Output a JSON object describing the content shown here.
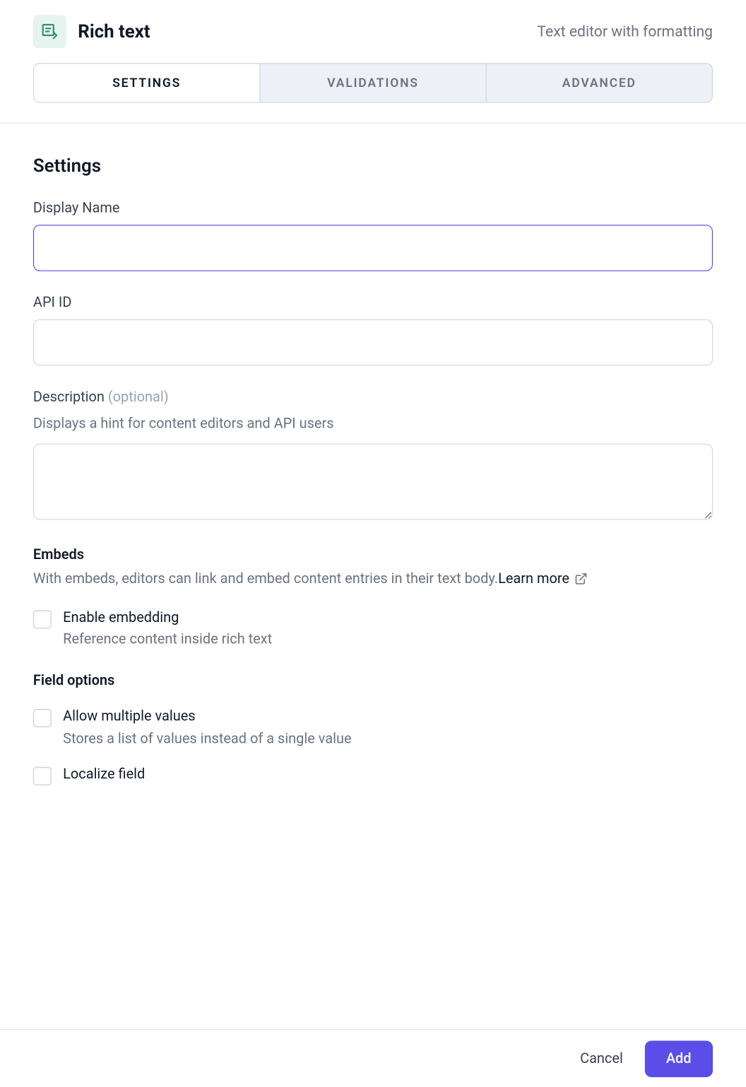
{
  "header": {
    "title": "Rich text",
    "subtitle": "Text editor with formatting",
    "icon": "rich-text-icon"
  },
  "tabs": {
    "items": [
      {
        "label": "Settings",
        "active": true
      },
      {
        "label": "Validations",
        "active": false
      },
      {
        "label": "Advanced",
        "active": false
      }
    ]
  },
  "settings": {
    "heading": "Settings",
    "displayName": {
      "label": "Display Name",
      "value": ""
    },
    "apiId": {
      "label": "API ID",
      "value": ""
    },
    "description": {
      "label": "Description",
      "optional": "(optional)",
      "hint": "Displays a hint for content editors and API users",
      "value": ""
    },
    "embeds": {
      "heading": "Embeds",
      "desc": "With embeds, editors can link and embed content entries in their text body.",
      "learn": "Learn more",
      "enable": {
        "label": "Enable embedding",
        "sub": "Reference content inside rich text",
        "checked": false
      }
    },
    "fieldOptions": {
      "heading": "Field options",
      "multiple": {
        "label": "Allow multiple values",
        "sub": "Stores a list of values instead of a single value",
        "checked": false
      },
      "localize": {
        "label": "Localize field",
        "checked": false
      }
    }
  },
  "footer": {
    "cancel": "Cancel",
    "add": "Add"
  }
}
